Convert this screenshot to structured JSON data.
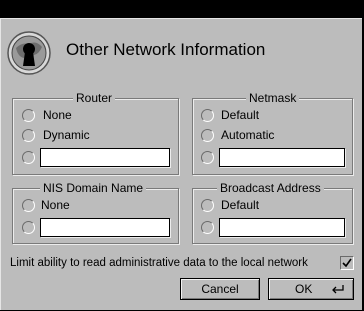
{
  "dialog": {
    "title": "Other Network Information",
    "logo_icon": "keyhole-globe-icon"
  },
  "router": {
    "legend": "Router",
    "options": [
      "None",
      "Dynamic"
    ],
    "custom_value": ""
  },
  "netmask": {
    "legend": "Netmask",
    "options": [
      "Default",
      "Automatic"
    ],
    "custom_value": ""
  },
  "nis": {
    "legend": "NIS Domain Name",
    "options": [
      "None"
    ],
    "custom_value": ""
  },
  "broadcast": {
    "legend": "Broadcast Address",
    "options": [
      "Default"
    ],
    "custom_value": ""
  },
  "limit": {
    "label": "Limit ability to read administrative data to the local network",
    "checked": true
  },
  "buttons": {
    "cancel": "Cancel",
    "ok": "OK"
  },
  "colors": {
    "background": "#bcbcbc",
    "titlebar": "#000000"
  }
}
